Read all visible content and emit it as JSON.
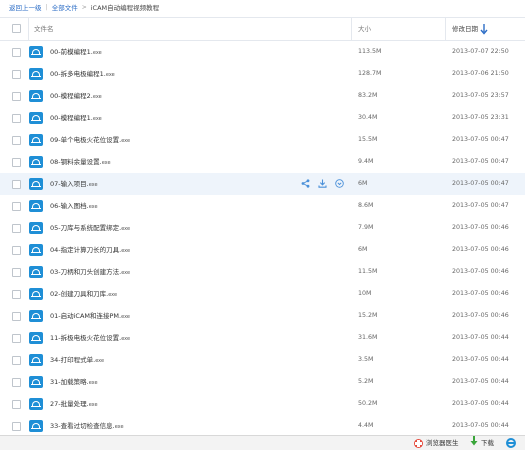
{
  "breadcrumb": {
    "back": "返回上一级",
    "all_files": "全部文件",
    "separator": "|",
    "arrow": ">",
    "current": "iCAM自动编程视频教程"
  },
  "table": {
    "col_name": "文件名",
    "col_size": "大小",
    "col_date": "修改日期",
    "sort_icon": "sort-desc-icon"
  },
  "files": [
    {
      "name": "00-前模编程1.",
      "ext": "exe",
      "size": "113.5M",
      "date": "2013-07-07 22:50"
    },
    {
      "name": "00-拆多电极编程1.",
      "ext": "exe",
      "size": "128.7M",
      "date": "2013-07-06 21:50"
    },
    {
      "name": "00-模程编程2.",
      "ext": "exe",
      "size": "83.2M",
      "date": "2013-07-05 23:57"
    },
    {
      "name": "00-模程编程1.",
      "ext": "exe",
      "size": "30.4M",
      "date": "2013-07-05 23:31"
    },
    {
      "name": "09-单个电极火花位设置.",
      "ext": "exe",
      "size": "15.5M",
      "date": "2013-07-05 00:47"
    },
    {
      "name": "08-钢料余量设置.",
      "ext": "exe",
      "size": "9.4M",
      "date": "2013-07-05 00:47"
    },
    {
      "name": "07-输入项目.",
      "ext": "exe",
      "size": "6M",
      "date": "2013-07-05 00:47"
    },
    {
      "name": "06-输入图档.",
      "ext": "exe",
      "size": "8.6M",
      "date": "2013-07-05 00:47"
    },
    {
      "name": "05-刀库与系统配置绑定.",
      "ext": "exe",
      "size": "7.9M",
      "date": "2013-07-05 00:46"
    },
    {
      "name": "04-指定计算刀长的刀具.",
      "ext": "exe",
      "size": "6M",
      "date": "2013-07-05 00:46"
    },
    {
      "name": "03-刀柄和刀头创建方法.",
      "ext": "exe",
      "size": "11.5M",
      "date": "2013-07-05 00:46"
    },
    {
      "name": "02-创建刀具和刀库.",
      "ext": "exe",
      "size": "10M",
      "date": "2013-07-05 00:46"
    },
    {
      "name": "01-启动iCAM和连接PM.",
      "ext": "exe",
      "size": "15.2M",
      "date": "2013-07-05 00:46"
    },
    {
      "name": "11-拆极电极火花位设置.",
      "ext": "exe",
      "size": "31.6M",
      "date": "2013-07-05 00:44"
    },
    {
      "name": "34-打印程式单.",
      "ext": "exe",
      "size": "3.5M",
      "date": "2013-07-05 00:44"
    },
    {
      "name": "31-加载策略.",
      "ext": "exe",
      "size": "5.2M",
      "date": "2013-07-05 00:44"
    },
    {
      "name": "27-批量处理.",
      "ext": "exe",
      "size": "50.2M",
      "date": "2013-07-05 00:44"
    },
    {
      "name": "33-查看过切检查信息.",
      "ext": "exe",
      "size": "4.4M",
      "date": "2013-07-05 00:44"
    }
  ],
  "hover_row_index": 6,
  "row_actions": [
    "share-icon",
    "download-icon",
    "more-icon"
  ],
  "status_bar": {
    "browser_doctor": "浏览器医生",
    "download": "下载"
  },
  "colors": {
    "link": "#2c6dc6",
    "file_icon": "#1f8fd6",
    "hover_row": "#eef4fb",
    "download_green": "#3aa63a"
  }
}
